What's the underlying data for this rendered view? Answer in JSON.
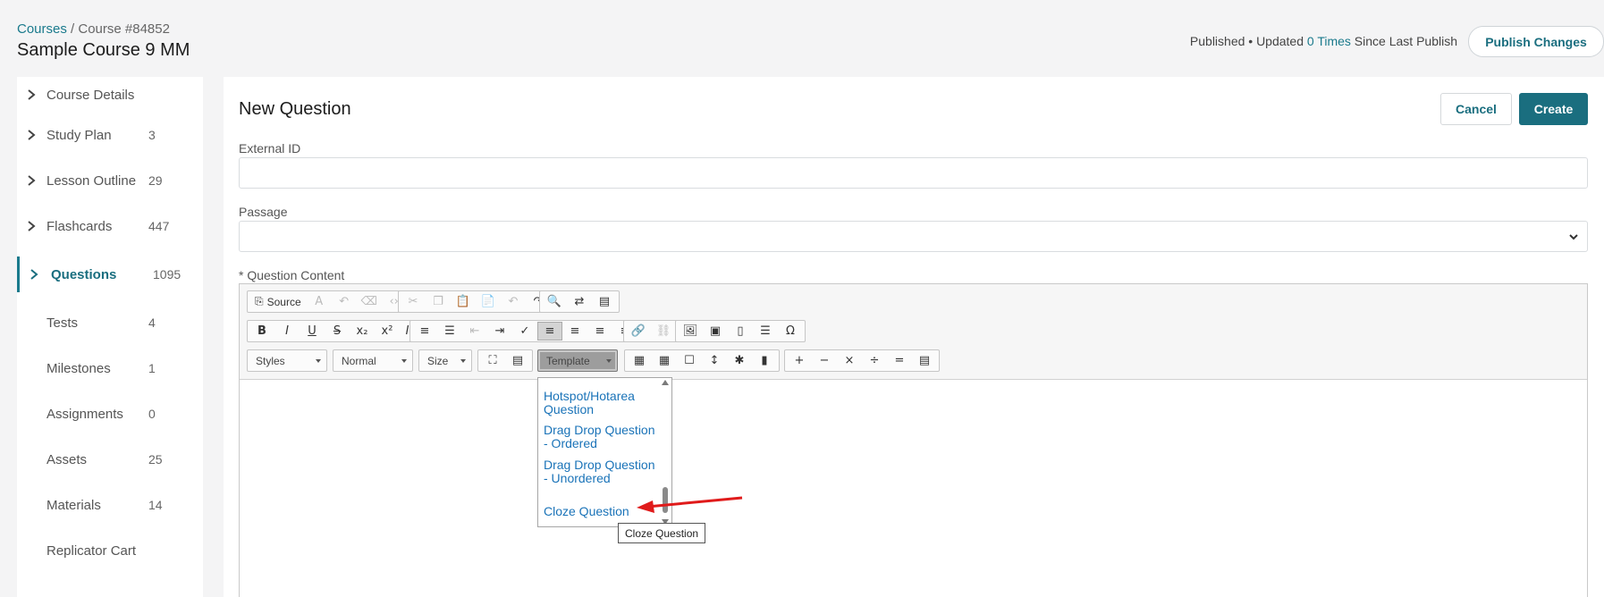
{
  "header": {
    "breadcrumb_root": "Courses",
    "breadcrumb_current": "/ Course #84852",
    "title": "Sample Course 9 MM",
    "status_prefix": "Published • Updated ",
    "status_count": "0 Times",
    "status_suffix": " Since Last Publish",
    "publish_label": "Publish Changes"
  },
  "sidebar": {
    "items": [
      {
        "label": "Course Details",
        "count": "",
        "chevron": true
      },
      {
        "label": "Study Plan",
        "count": "3",
        "chevron": true
      },
      {
        "label": "Lesson Outline",
        "count": "29",
        "chevron": true
      },
      {
        "label": "Flashcards",
        "count": "447",
        "chevron": true
      },
      {
        "label": "Questions",
        "count": "1095",
        "chevron": true,
        "active": true
      },
      {
        "label": "Tests",
        "count": "4"
      },
      {
        "label": "Milestones",
        "count": "1"
      },
      {
        "label": "Assignments",
        "count": "0"
      },
      {
        "label": "Assets",
        "count": "25"
      },
      {
        "label": "Materials",
        "count": "14"
      },
      {
        "label": "Replicator Cart",
        "count": ""
      }
    ]
  },
  "form": {
    "title": "New Question",
    "cancel_label": "Cancel",
    "create_label": "Create",
    "external_id_label": "External ID",
    "external_id_value": "",
    "passage_label": "Passage",
    "passage_value": "",
    "content_label": "* Question Content"
  },
  "editor": {
    "source_label": "Source",
    "styles_label": "Styles",
    "format_label": "Normal",
    "size_label": "Size",
    "template_label": "Template"
  },
  "template_dropdown": {
    "items": [
      "Hotspot/Hotarea Question",
      "Drag Drop Question - Ordered",
      "Drag Drop Question - Unordered",
      "Cloze Question"
    ],
    "tooltip": "Cloze Question"
  },
  "colors": {
    "accent": "#1a6e7f",
    "link": "#1a73b8",
    "annotation_arrow": "#e01b1b"
  }
}
